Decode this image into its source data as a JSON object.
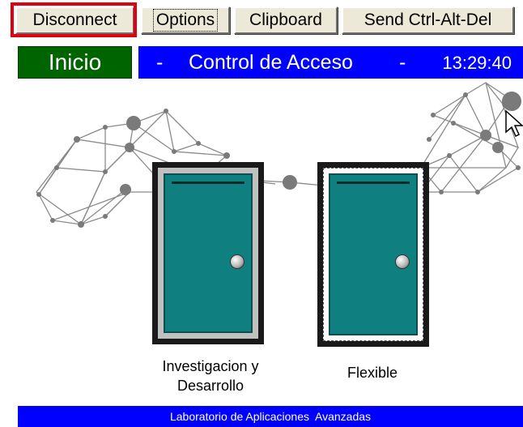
{
  "toolbar": {
    "disconnect_label": "Disconnect",
    "options_label": "Options",
    "clipboard_label": "Clipboard",
    "ctrl_alt_del_label": "Send Ctrl-Alt-Del"
  },
  "header": {
    "inicio_label": "Inicio",
    "dash_left": "-",
    "title": "Control de Acceso",
    "dash_right": "-",
    "time": "13:29:40"
  },
  "doors": [
    {
      "label_line1": "Investigacion y",
      "label_line2": "Desarrollo"
    },
    {
      "label_line1": "Flexible"
    }
  ],
  "footer": {
    "text": "Laboratorio de Aplicaciones  Avanzadas"
  },
  "colors": {
    "inicio_bg": "#006400",
    "title_bg": "#0000ff",
    "footer_bg": "#0000ff",
    "door_teal": "#0f7f7f",
    "highlight_red": "#e00010"
  }
}
